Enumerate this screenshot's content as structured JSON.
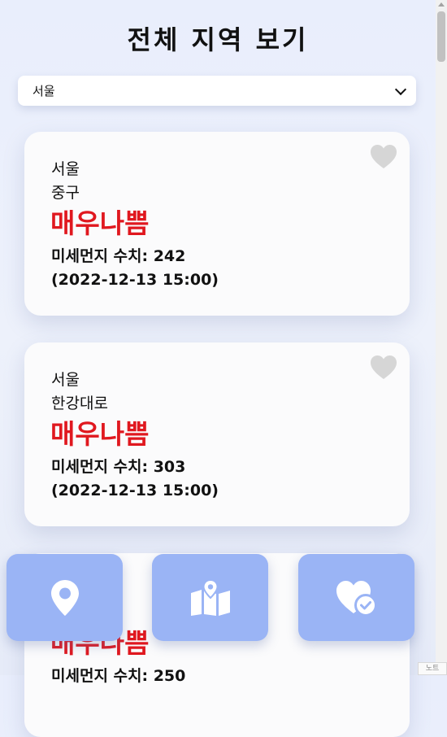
{
  "page": {
    "title": "전체 지역 보기"
  },
  "region_select": {
    "selected": "서울"
  },
  "cards": [
    {
      "city": "서울",
      "district": "중구",
      "status": "매우나쁨",
      "metric_label": "미세먼지 수치: 242",
      "time": "(2022-12-13 15:00)"
    },
    {
      "city": "서울",
      "district": "한강대로",
      "status": "매우나쁨",
      "metric_label": "미세먼지 수치: 303",
      "time": "(2022-12-13 15:00)"
    },
    {
      "status": "매우나쁨",
      "metric_label": "미세먼지 수치: 250"
    }
  ],
  "colors": {
    "status_bad": "#e0181f",
    "nav_button": "#9ab4f5",
    "heart_inactive": "#d6d6d6"
  },
  "nav": {
    "buttons": [
      {
        "icon": "location-pin-icon"
      },
      {
        "icon": "map-icon"
      },
      {
        "icon": "favorites-heart-check-icon"
      }
    ]
  },
  "corner_badge": {
    "text": "노트"
  }
}
